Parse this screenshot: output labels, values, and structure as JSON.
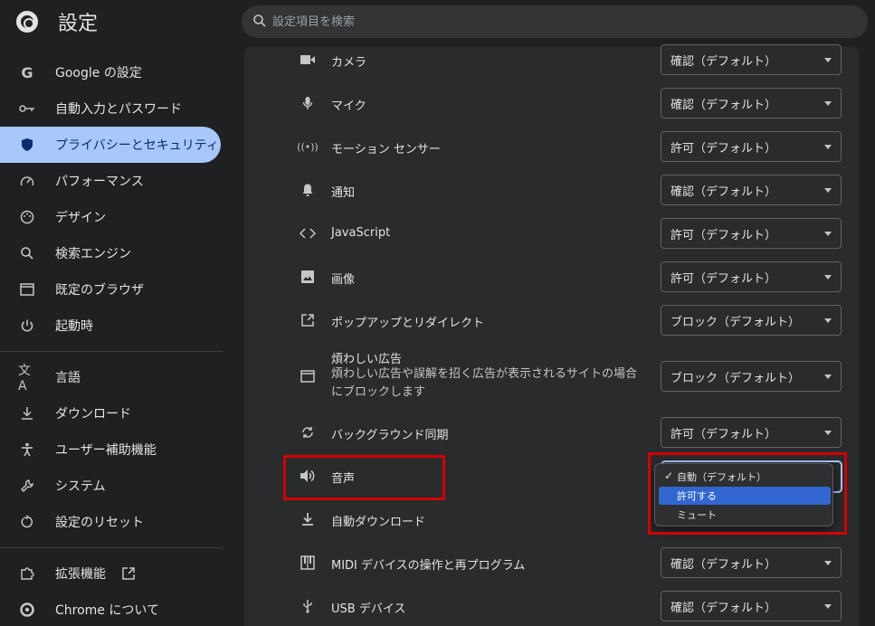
{
  "header": {
    "title": "設定",
    "search_placeholder": "設定項目を検索"
  },
  "sidebar": {
    "items": [
      {
        "label": "Google の設定",
        "icon": "google-g-icon"
      },
      {
        "label": "自動入力とパスワード",
        "icon": "key-icon"
      },
      {
        "label": "プライバシーとセキュリティ",
        "icon": "shield-icon",
        "active": true
      },
      {
        "label": "パフォーマンス",
        "icon": "speedometer-icon"
      },
      {
        "label": "デザイン",
        "icon": "palette-icon"
      },
      {
        "label": "検索エンジン",
        "icon": "search-icon"
      },
      {
        "label": "既定のブラウザ",
        "icon": "browser-window-icon"
      },
      {
        "label": "起動時",
        "icon": "power-icon"
      },
      {
        "label": "言語",
        "icon": "translate-icon"
      },
      {
        "label": "ダウンロード",
        "icon": "download-icon"
      },
      {
        "label": "ユーザー補助機能",
        "icon": "accessibility-icon"
      },
      {
        "label": "システム",
        "icon": "wrench-icon"
      },
      {
        "label": "設定のリセット",
        "icon": "reset-icon"
      },
      {
        "label": "拡張機能",
        "icon": "puzzle-icon"
      },
      {
        "label": "Chrome について",
        "icon": "chrome-icon"
      }
    ]
  },
  "permissions": [
    {
      "label": "カメラ",
      "icon": "camera-icon",
      "value": "確認（デフォルト）"
    },
    {
      "label": "マイク",
      "icon": "microphone-icon",
      "value": "確認（デフォルト）"
    },
    {
      "label": "モーション センサー",
      "icon": "motion-sensor-icon",
      "value": "許可（デフォルト）"
    },
    {
      "label": "通知",
      "icon": "bell-icon",
      "value": "確認（デフォルト）"
    },
    {
      "label": "JavaScript",
      "icon": "code-icon",
      "value": "許可（デフォルト）"
    },
    {
      "label": "画像",
      "icon": "image-icon",
      "value": "許可（デフォルト）"
    },
    {
      "label": "ポップアップとリダイレクト",
      "icon": "open-in-new-icon",
      "value": "ブロック（デフォルト）"
    },
    {
      "label": "煩わしい広告",
      "sublabel_1": "煩わしい広告や誤解を招く広告が表示されるサイトの場合",
      "sublabel_2": "にブロックします",
      "icon": "ad-window-icon",
      "value": "ブロック（デフォルト）"
    },
    {
      "label": "バックグラウンド同期",
      "icon": "sync-icon",
      "value": "許可（デフォルト）"
    },
    {
      "label": "音声",
      "icon": "speaker-icon",
      "value": "自動（デフォルト）"
    },
    {
      "label": "自動ダウンロード",
      "icon": "download-icon",
      "value": ""
    },
    {
      "label": "MIDI デバイスの操作と再プログラム",
      "icon": "piano-icon",
      "value": "確認（デフォルト）"
    },
    {
      "label": "USB デバイス",
      "icon": "usb-icon",
      "value": "確認（デフォルト）"
    }
  ],
  "sound_dropdown": {
    "options": [
      "自動（デフォルト）",
      "許可する",
      "ミュート"
    ],
    "selected": "自動（デフォルト）",
    "highlighted": "許可する",
    "check_mark": "✓"
  },
  "colors": {
    "background": "#1f2022",
    "content": "#2a2b2d",
    "active_item": "#a8c7fa",
    "highlight": "#3266d0",
    "annotation": "#d40000"
  }
}
